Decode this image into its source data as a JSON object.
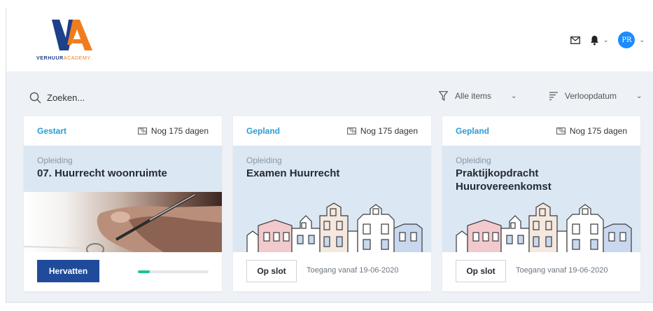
{
  "brand": {
    "name_part1": "VERHUUR",
    "name_part2": "ACADEMY",
    "color_primary": "#1e3f8a",
    "color_accent": "#f07c1e"
  },
  "header": {
    "icons": [
      "mail-icon",
      "bell-icon",
      "chevron-down-icon"
    ],
    "avatar_initials": "PR"
  },
  "toolbar": {
    "search_placeholder": "Zoeken...",
    "filter_value": "Alle items",
    "sort_value": "Verloopdatum"
  },
  "cards": [
    {
      "status": "Gestart",
      "due": "Nog 175 dagen",
      "kind": "Opleiding",
      "title": "07. Huurrecht woonruimte",
      "action_label": "Hervatten",
      "progress": 0.17
    },
    {
      "status": "Gepland",
      "due": "Nog 175 dagen",
      "kind": "Opleiding",
      "title": "Examen Huurrecht",
      "action_label": "Op slot",
      "access_text": "Toegang vanaf 19-06-2020"
    },
    {
      "status": "Gepland",
      "due": "Nog 175 dagen",
      "kind": "Opleiding",
      "title": "Praktijkopdracht Huurovereenkomst",
      "action_label": "Op slot",
      "access_text": "Toegang vanaf 19-06-2020"
    }
  ]
}
